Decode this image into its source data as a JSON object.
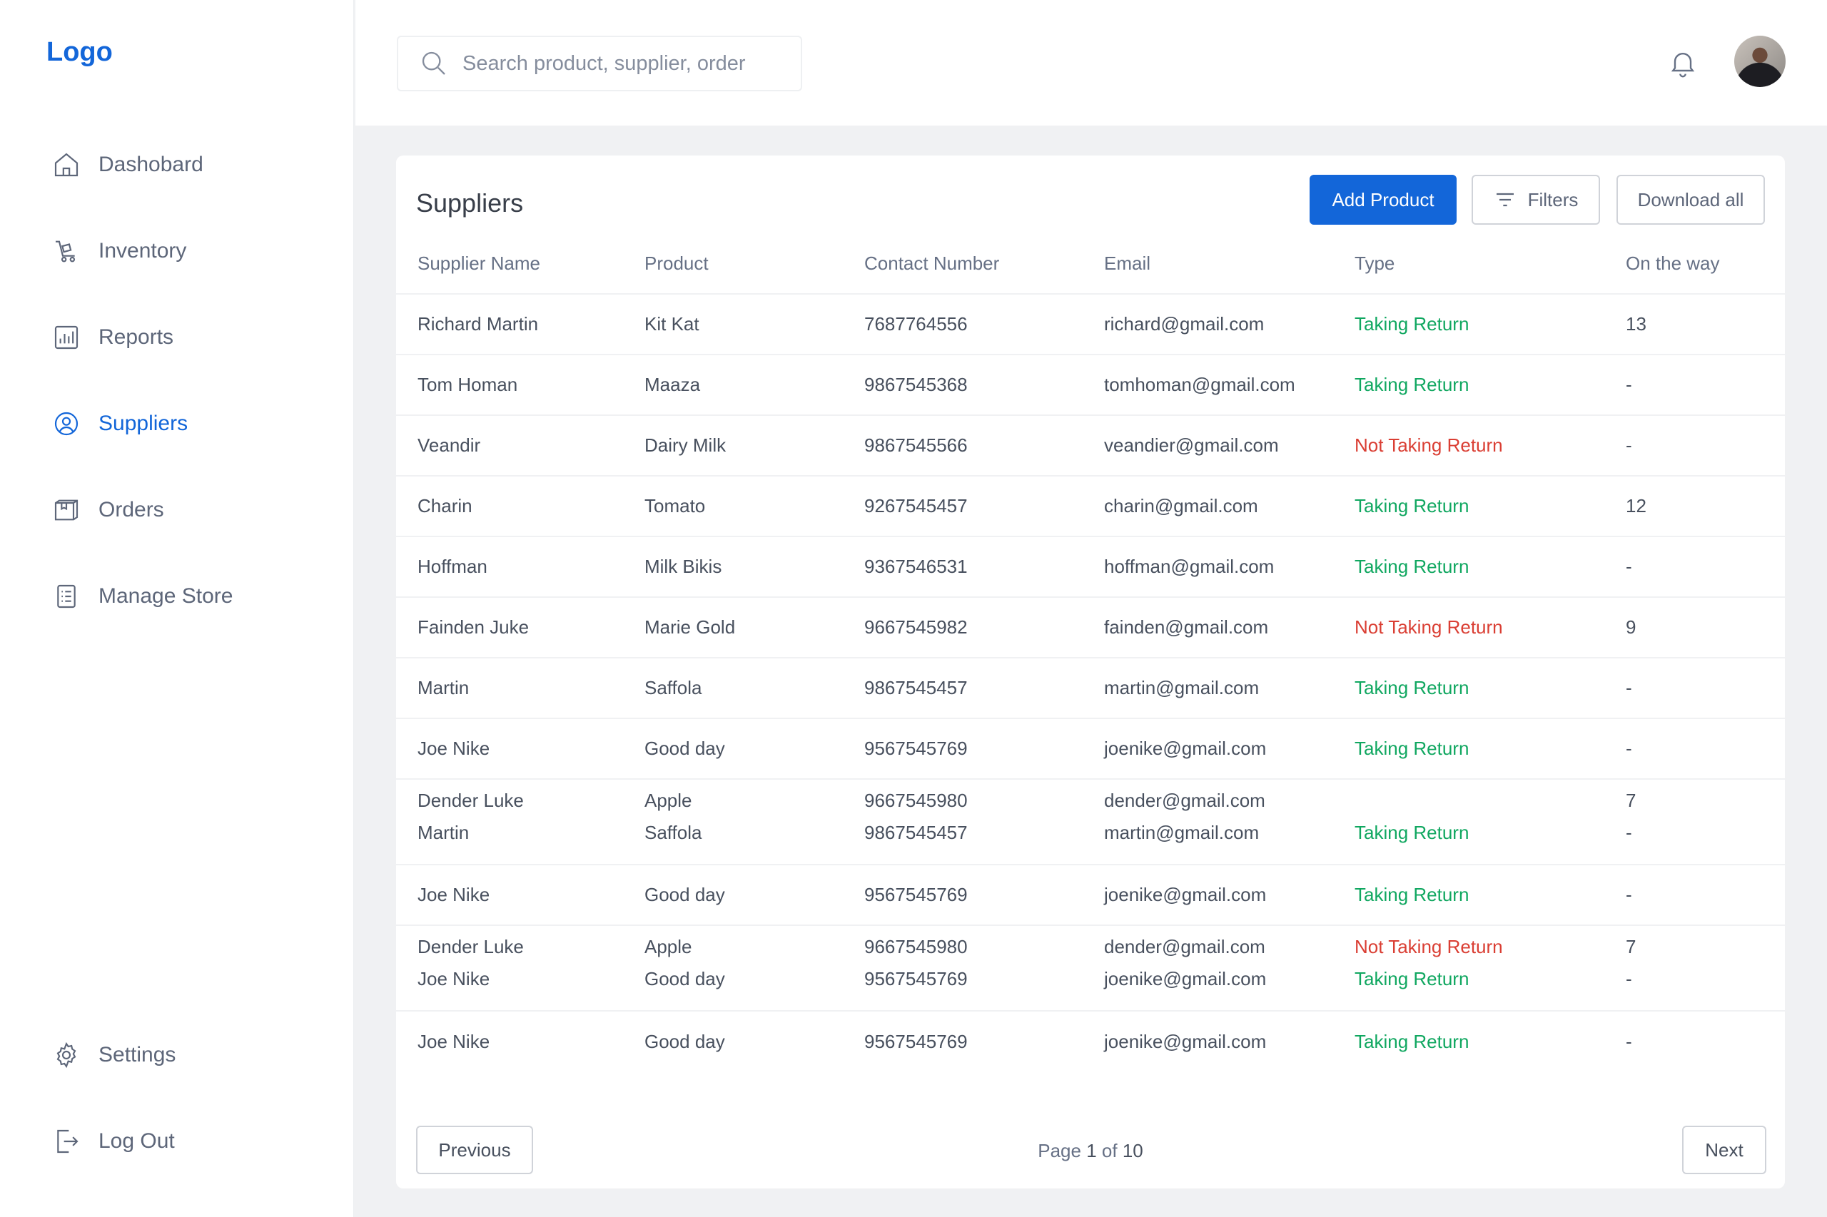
{
  "sidebar": {
    "logo": "Logo",
    "items": [
      {
        "label": "Dashobard",
        "icon": "home-icon"
      },
      {
        "label": "Inventory",
        "icon": "inventory-icon"
      },
      {
        "label": "Reports",
        "icon": "reports-icon"
      },
      {
        "label": "Suppliers",
        "icon": "suppliers-icon",
        "active": true
      },
      {
        "label": "Orders",
        "icon": "orders-icon"
      },
      {
        "label": "Manage Store",
        "icon": "manage-store-icon"
      }
    ],
    "bottom_items": [
      {
        "label": "Settings",
        "icon": "gear-icon"
      },
      {
        "label": "Log Out",
        "icon": "logout-icon"
      }
    ]
  },
  "header": {
    "search_placeholder": "Search product, supplier, order"
  },
  "colors": {
    "accent": "#1366d9",
    "taking_return": "#10a760",
    "not_taking_return": "#da3e33"
  },
  "suppliers": {
    "title": "Suppliers",
    "add_button": "Add Product",
    "filters_button": "Filters",
    "download_button": "Download all",
    "columns": [
      "Supplier Name",
      "Product",
      "Contact Number",
      "Email",
      "Type",
      "On the way"
    ],
    "rows": [
      {
        "name": "Richard Martin",
        "product": "Kit Kat",
        "contact": "7687764556",
        "email": "richard@gmail.com",
        "type": "Taking Return",
        "on_the_way": "13"
      },
      {
        "name": "Tom Homan",
        "product": "Maaza",
        "contact": "9867545368",
        "email": "tomhoman@gmail.com",
        "type": "Taking Return",
        "on_the_way": "-"
      },
      {
        "name": "Veandir",
        "product": "Dairy Milk",
        "contact": "9867545566",
        "email": "veandier@gmail.com",
        "type": "Not Taking Return",
        "on_the_way": "-"
      },
      {
        "name": "Charin",
        "product": "Tomato",
        "contact": "9267545457",
        "email": "charin@gmail.com",
        "type": "Taking Return",
        "on_the_way": "12"
      },
      {
        "name": "Hoffman",
        "product": "Milk Bikis",
        "contact": "9367546531",
        "email": "hoffman@gmail.com",
        "type": "Taking Return",
        "on_the_way": "-"
      },
      {
        "name": "Fainden Juke",
        "product": "Marie Gold",
        "contact": "9667545982",
        "email": "fainden@gmail.com",
        "type": "Not Taking Return",
        "on_the_way": "9"
      },
      {
        "name": "Martin",
        "product": "Saffola",
        "contact": "9867545457",
        "email": "martin@gmail.com",
        "type": "Taking Return",
        "on_the_way": "-"
      },
      {
        "name": "Joe Nike",
        "product": "Good day",
        "contact": "9567545769",
        "email": "joenike@gmail.com",
        "type": "Taking Return",
        "on_the_way": "-"
      },
      {
        "name": "Dender Luke",
        "product": "Apple",
        "contact": "9667545980",
        "email": "dender@gmail.com",
        "type": "",
        "on_the_way": "7",
        "tight": true
      },
      {
        "name": "Martin",
        "product": "Saffola",
        "contact": "9867545457",
        "email": "martin@gmail.com",
        "type": "Taking Return",
        "on_the_way": "-",
        "after_tight": true
      },
      {
        "name": "Joe Nike",
        "product": "Good day",
        "contact": "9567545769",
        "email": "joenike@gmail.com",
        "type": "Taking Return",
        "on_the_way": "-"
      },
      {
        "name": "Dender Luke",
        "product": "Apple",
        "contact": "9667545980",
        "email": "dender@gmail.com",
        "type": "Not Taking Return",
        "on_the_way": "7",
        "tight": true
      },
      {
        "name": "Joe Nike",
        "product": "Good day",
        "contact": "9567545769",
        "email": "joenike@gmail.com",
        "type": "Taking Return",
        "on_the_way": "-",
        "after_tight": true
      },
      {
        "name": "Joe Nike",
        "product": "Good day",
        "contact": "9567545769",
        "email": "joenike@gmail.com",
        "type": "Taking Return",
        "on_the_way": "-",
        "last": true
      }
    ],
    "pagination": {
      "previous": "Previous",
      "next": "Next",
      "page_word": "Page",
      "current": "1",
      "of_word": "of",
      "total": "10"
    }
  }
}
